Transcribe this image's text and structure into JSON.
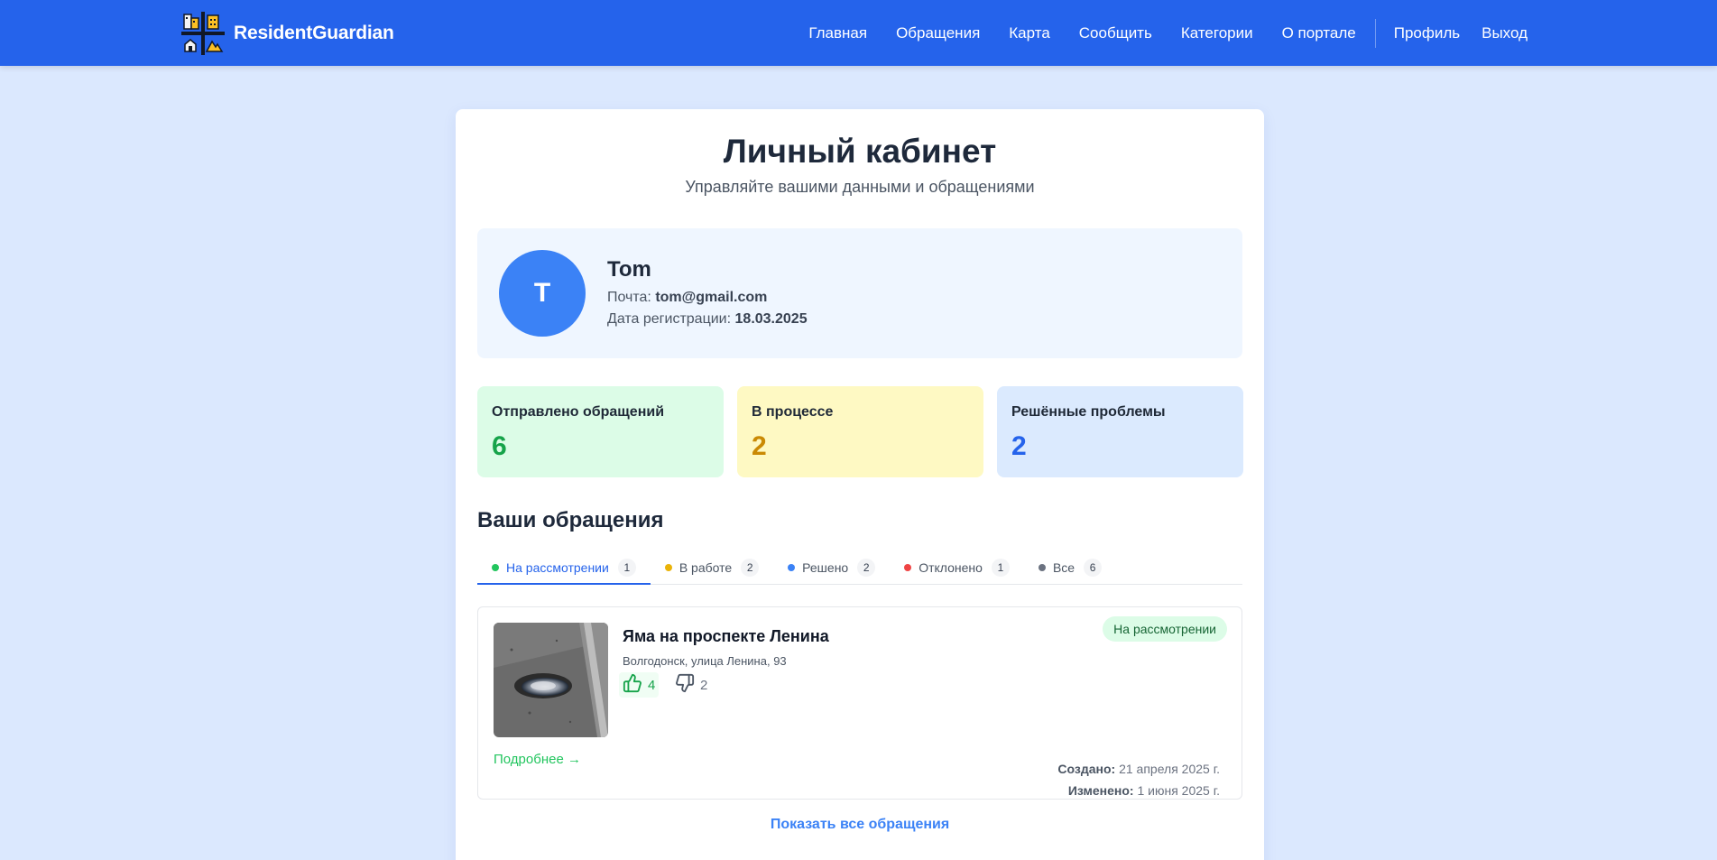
{
  "header": {
    "brand": "ResidentGuardian",
    "nav": [
      "Главная",
      "Обращения",
      "Карта",
      "Сообщить",
      "Категории",
      "О портале"
    ],
    "profile_link": "Профиль",
    "logout_link": "Выход",
    "bg_color": "#2563eb"
  },
  "page": {
    "title": "Личный кабинет",
    "subtitle": "Управляйте вашими данными и обращениями"
  },
  "profile": {
    "avatar_letter": "T",
    "name": "Tom",
    "email_label": "Почта:",
    "email": "tom@gmail.com",
    "reg_label": "Дата регистрации:",
    "reg_date": "18.03.2025"
  },
  "stats": {
    "sent": {
      "label": "Отправлено обращений",
      "value": "6",
      "color": "#16a34a"
    },
    "in_progress": {
      "label": "В процессе",
      "value": "2",
      "color": "#ca8a04"
    },
    "resolved": {
      "label": "Решённые проблемы",
      "value": "2",
      "color": "#2563eb"
    }
  },
  "section_title": "Ваши обращения",
  "tabs": [
    {
      "label": "На рассмотрении",
      "count": "1",
      "color": "#22c55e"
    },
    {
      "label": "В работе",
      "count": "2",
      "color": "#eab308"
    },
    {
      "label": "Решено",
      "count": "2",
      "color": "#3b82f6"
    },
    {
      "label": "Отклонено",
      "count": "1",
      "color": "#ef4444"
    },
    {
      "label": "Все",
      "count": "6",
      "color": "#6b7280"
    }
  ],
  "issue": {
    "title": "Яма на проспекте Ленина",
    "address": "Волгодонск, улица Ленина, 93",
    "likes": "4",
    "dislikes": "2",
    "status": "На рассмотрении",
    "more_link": "Подробнее →",
    "created_label": "Создано:",
    "created": "21 апреля 2025 г.",
    "updated_label": "Изменено:",
    "updated": "1 июня 2025 г."
  },
  "show_all": "Показать все обращения"
}
